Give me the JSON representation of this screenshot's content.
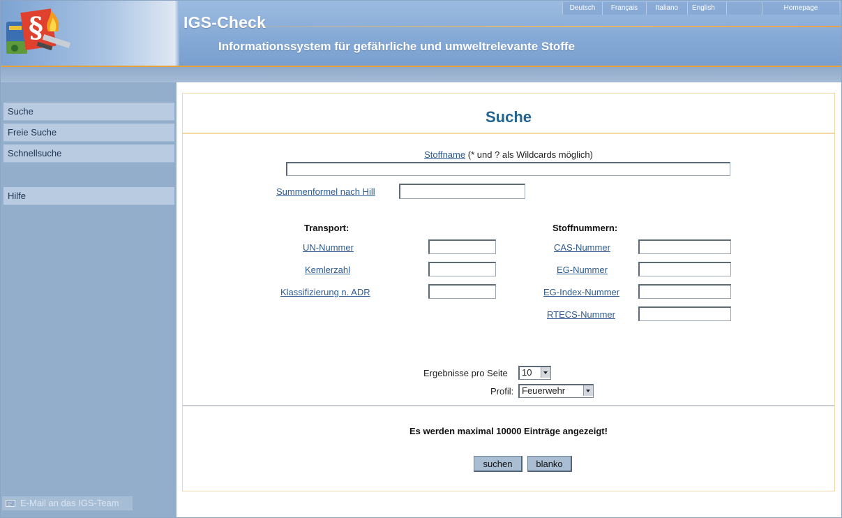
{
  "header": {
    "title": "IGS-Check",
    "subtitle": "Informationssystem für gefährliche und umweltrelevante Stoffe",
    "languages": [
      {
        "label": "Deutsch"
      },
      {
        "label": "Français"
      },
      {
        "label": "Italiano"
      },
      {
        "label": "English"
      },
      {
        "label": "Homepage"
      }
    ]
  },
  "sidebar": {
    "items": [
      {
        "label": "Suche"
      },
      {
        "label": "Freie Suche"
      },
      {
        "label": "Schnellsuche"
      },
      {
        "label": "Hilfe"
      }
    ],
    "mail_label": "E-Mail an das IGS-Team"
  },
  "search": {
    "title": "Suche",
    "stoffname_link": "Stoffname",
    "stoffname_hint": "(* und ? als Wildcards möglich)",
    "stoffname_value": "",
    "summenformel_link": "Summenformel nach Hill",
    "summenformel_value": "",
    "transport": {
      "heading": "Transport:",
      "fields": [
        {
          "label": "UN-Nummer",
          "value": ""
        },
        {
          "label": "Kemlerzahl",
          "value": ""
        },
        {
          "label": "Klassifizierung n. ADR",
          "value": ""
        }
      ]
    },
    "stoffnummern": {
      "heading": "Stoffnummern:",
      "fields": [
        {
          "label": "CAS-Nummer",
          "value": ""
        },
        {
          "label": "EG-Nummer",
          "value": ""
        },
        {
          "label": "EG-Index-Nummer",
          "value": ""
        },
        {
          "label": "RTECS-Nummer",
          "value": ""
        }
      ]
    },
    "results_per_page_label": "Ergebnisse pro Seite",
    "results_per_page_value": "10",
    "profile_label": "Profil:",
    "profile_value": "Feuerwehr",
    "max_note": "Es werden maximal 10000 Einträge angezeigt!",
    "submit_label": "suchen",
    "reset_label": "blanko"
  },
  "colors": {
    "header_blue": "#86aad6",
    "sidebar_blue": "#92aecb",
    "title_blue": "#23638f",
    "accent_orange": "#e6a03c",
    "link_blue": "#2e5c91"
  }
}
